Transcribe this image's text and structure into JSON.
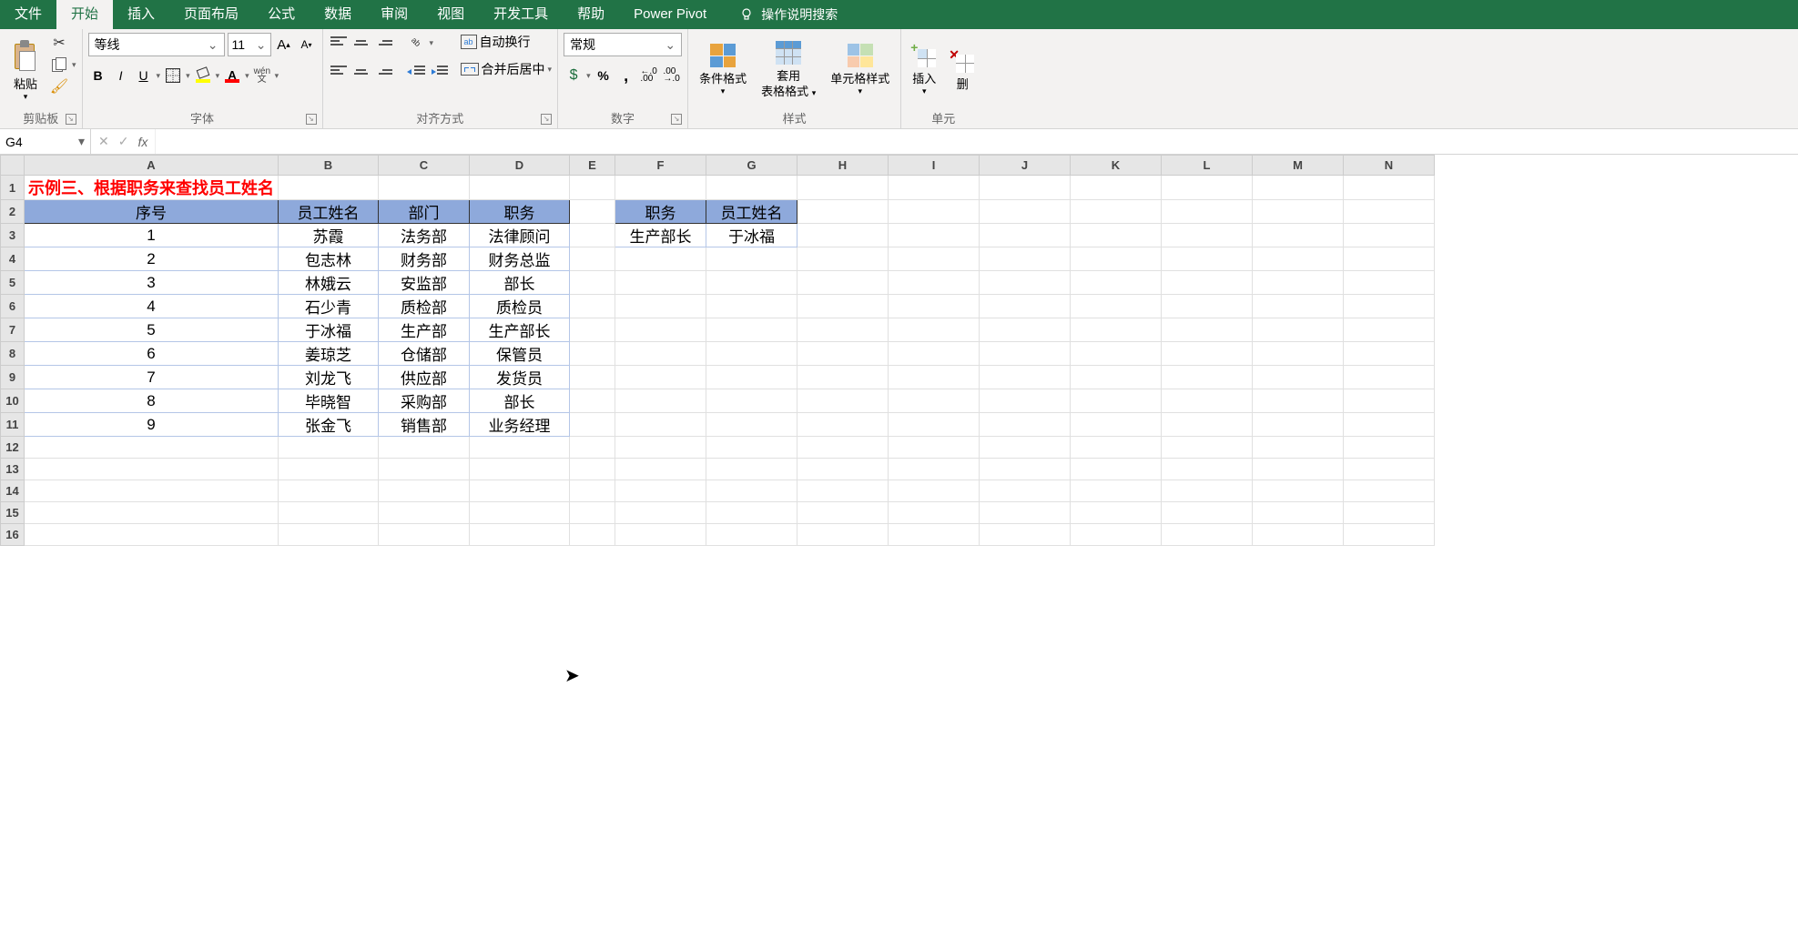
{
  "tabs": {
    "file": "文件",
    "home": "开始",
    "insert": "插入",
    "page_layout": "页面布局",
    "formulas": "公式",
    "data": "数据",
    "review": "审阅",
    "view": "视图",
    "developer": "开发工具",
    "help": "帮助",
    "power_pivot": "Power Pivot",
    "tell_me": "操作说明搜索"
  },
  "ribbon": {
    "clipboard": {
      "label": "剪贴板",
      "paste": "粘贴"
    },
    "font": {
      "label": "字体",
      "name": "等线",
      "size": "11",
      "bold": "B",
      "italic": "I",
      "underline": "U",
      "wen": "wén",
      "wen2": "文"
    },
    "alignment": {
      "label": "对齐方式",
      "wrap": "自动换行",
      "merge": "合并后居中"
    },
    "number": {
      "label": "数字",
      "format": "常规",
      "inc_dec1": ".0",
      "inc_dec2": ".00"
    },
    "styles": {
      "label": "样式",
      "cond_fmt": "条件格式",
      "tbl_fmt": "套用",
      "tbl_fmt2": "表格格式",
      "cell_style": "单元格样式"
    },
    "cells": {
      "label": "单元",
      "insert": "插入",
      "delete": "删"
    }
  },
  "formula_bar": {
    "name_box": "G4",
    "formula": ""
  },
  "columns": [
    "A",
    "B",
    "C",
    "D",
    "E",
    "F",
    "G",
    "H",
    "I",
    "J",
    "K",
    "L",
    "M",
    "N"
  ],
  "sheet": {
    "title": "示例三、根据职务来查找员工姓名",
    "headers": [
      "序号",
      "员工姓名",
      "部门",
      "职务"
    ],
    "rows": [
      [
        "1",
        "苏霞",
        "法务部",
        "法律顾问"
      ],
      [
        "2",
        "包志林",
        "财务部",
        "财务总监"
      ],
      [
        "3",
        "林娥云",
        "安监部",
        "部长"
      ],
      [
        "4",
        "石少青",
        "质检部",
        "质检员"
      ],
      [
        "5",
        "于冰福",
        "生产部",
        "生产部长"
      ],
      [
        "6",
        "姜琼芝",
        "仓储部",
        "保管员"
      ],
      [
        "7",
        "刘龙飞",
        "供应部",
        "发货员"
      ],
      [
        "8",
        "毕晓智",
        "采购部",
        "部长"
      ],
      [
        "9",
        "张金飞",
        "销售部",
        "业务经理"
      ]
    ],
    "lookup_headers": [
      "职务",
      "员工姓名"
    ],
    "lookup_row": [
      "生产部长",
      "于冰福"
    ]
  }
}
